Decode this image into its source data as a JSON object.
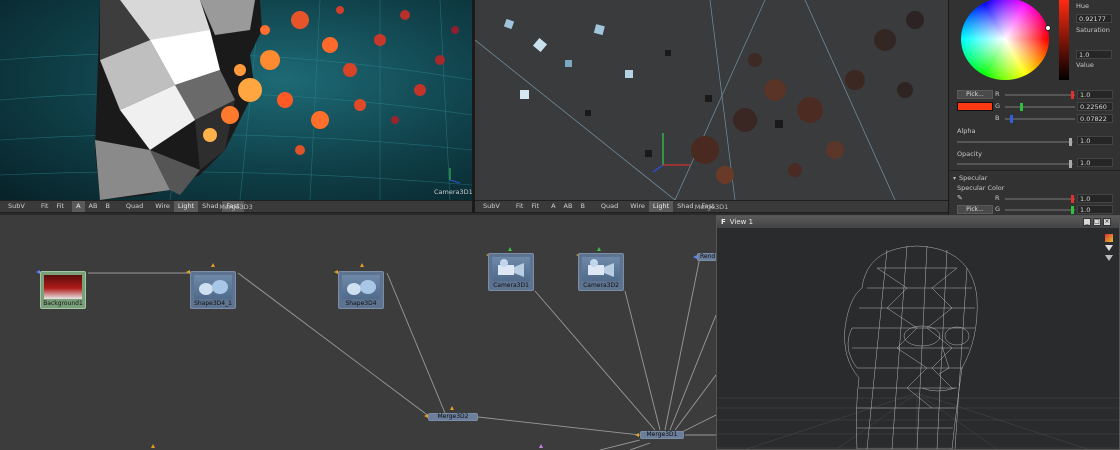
{
  "viewer_left": {
    "overlay_label": "Camera3D1",
    "toolbar": [
      "SubV",
      "Fit",
      "Fit",
      "A",
      "AB",
      "B",
      "Quad",
      "Wire",
      "Light",
      "Shad",
      "Fast"
    ],
    "title": "Merge3D3"
  },
  "viewer_right": {
    "toolbar": [
      "SubV",
      "Fit",
      "Fit",
      "A",
      "AB",
      "B",
      "Quad",
      "Wire",
      "Light",
      "Shad",
      "Fast"
    ],
    "title": "Merge3D1"
  },
  "inspector": {
    "hue_label": "Hue",
    "hue_value": "0.92177",
    "saturation_label": "Saturation",
    "saturation_value": "1.0",
    "value_label": "Value",
    "pick_label": "Pick...",
    "r_label": "R",
    "r_value": "1.0",
    "g_label": "G",
    "g_value": "0.22560",
    "b_label": "B",
    "b_value": "0.07822",
    "alpha_label": "Alpha",
    "alpha_value": "1.0",
    "opacity_label": "Opacity",
    "opacity_value": "1.0",
    "specular_label": "Specular",
    "specular_color_label": "Specular Color",
    "spec_r_value": "1.0",
    "spec_g_value": "1.0",
    "swatch_color": "#ff3a12"
  },
  "flow": {
    "nodes": {
      "background1": "Background1",
      "shape3d4_1": "Shape3D4_1",
      "shape3d4": "Shape3D4",
      "camera3d1": "Camera3D1",
      "camera3d2": "Camera3D2",
      "merge3d2": "Merge3D2",
      "merge3d1": "Merge3D1",
      "render": "Rend"
    }
  },
  "view1": {
    "title": "View 1"
  }
}
